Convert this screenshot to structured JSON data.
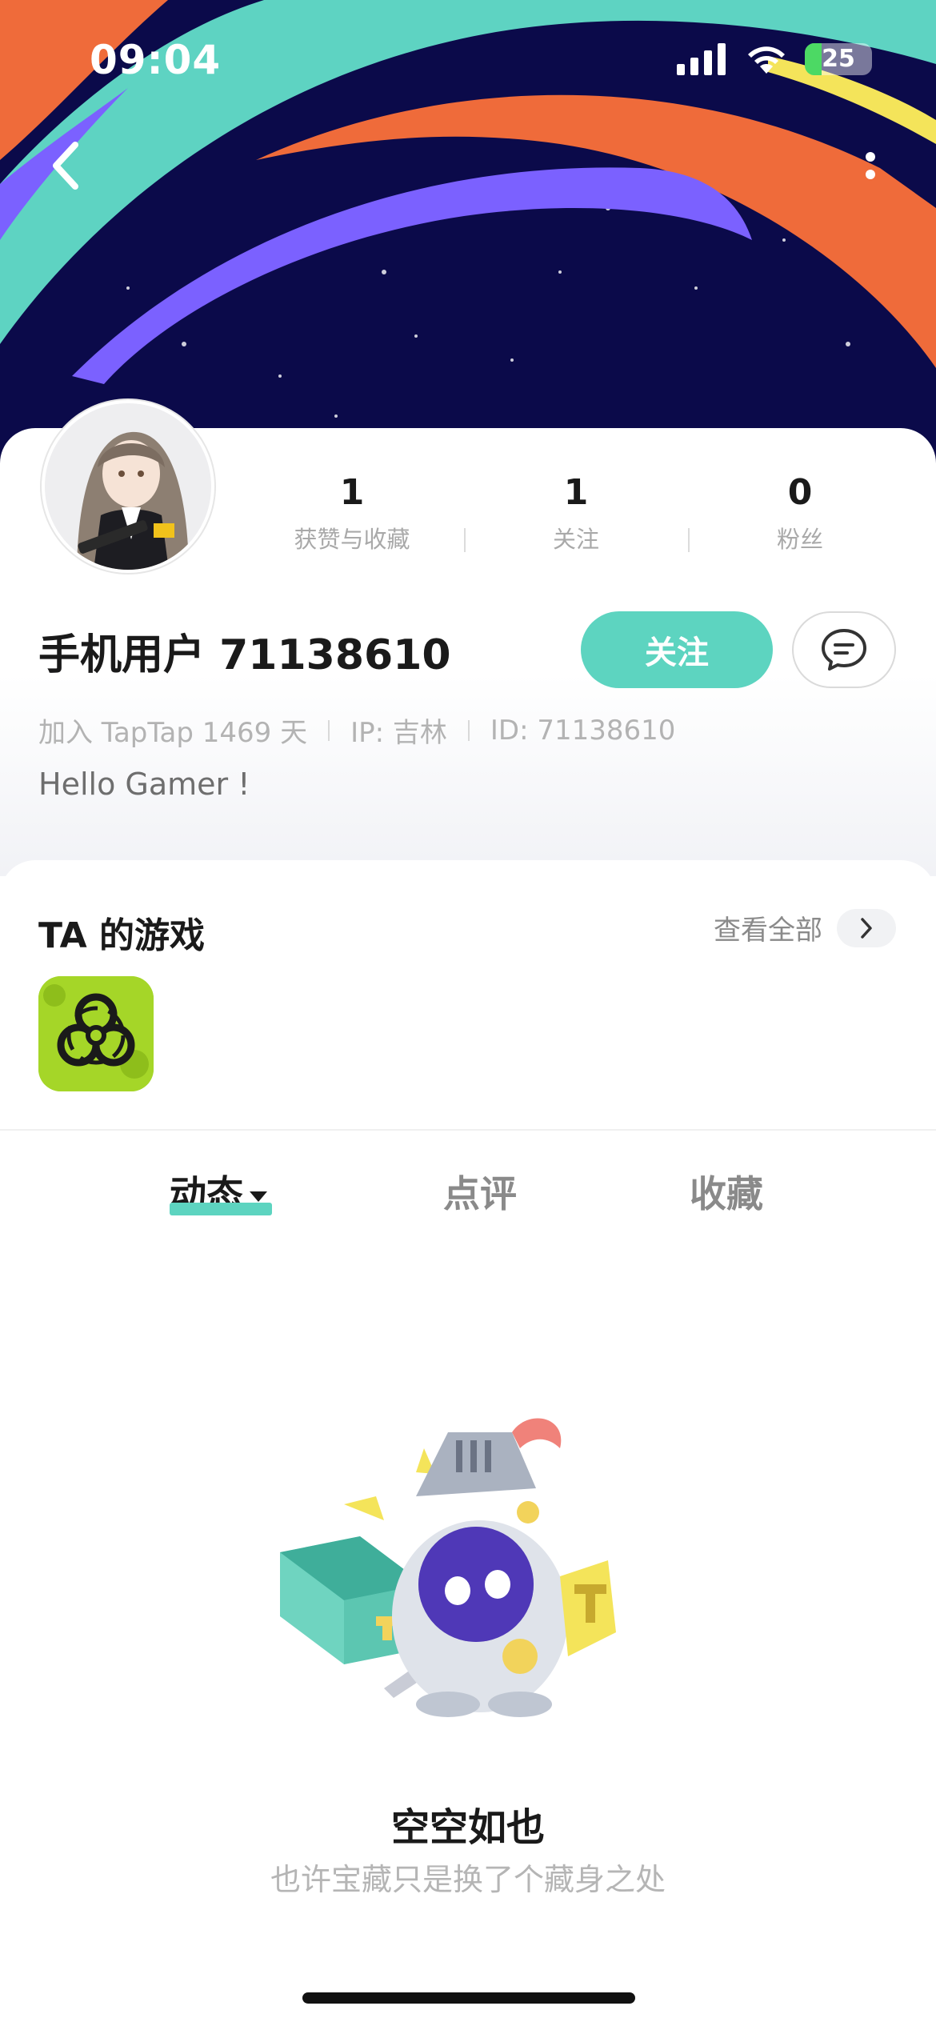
{
  "status_bar": {
    "time": "09:04",
    "battery_level": "25",
    "battery_fraction": 0.25,
    "icons": [
      "signal-icon",
      "wifi-icon",
      "battery-charging-icon"
    ]
  },
  "nav": {
    "back_icon": "chevron-left-icon",
    "more_icon": "more-vertical-icon"
  },
  "profile": {
    "stats": [
      {
        "value": "1",
        "label": "获赞与收藏"
      },
      {
        "value": "1",
        "label": "关注"
      },
      {
        "value": "0",
        "label": "粉丝"
      }
    ],
    "username": "手机用户 71138610",
    "follow_label": "关注",
    "meta": {
      "joined": "加入 TapTap 1469 天",
      "ip": "IP: 吉林",
      "id": "ID: 71138610"
    },
    "bio": "Hello Gamer !"
  },
  "games": {
    "title": "TA 的游戏",
    "view_all_label": "查看全部"
  },
  "tabs": [
    {
      "label": "动态",
      "active": true
    },
    {
      "label": "点评",
      "active": false
    },
    {
      "label": "收藏",
      "active": false
    }
  ],
  "empty_state": {
    "title": "空空如也",
    "subtitle": "也许宝藏只是换了个藏身之处"
  },
  "colors": {
    "accent": "#5dd4c0",
    "banner_bg": "#0b0a4a",
    "stripe_teal": "#5ed3c2",
    "stripe_orange": "#ef6b3a",
    "stripe_purple": "#7b61ff",
    "stripe_yellow": "#f4e45a"
  }
}
